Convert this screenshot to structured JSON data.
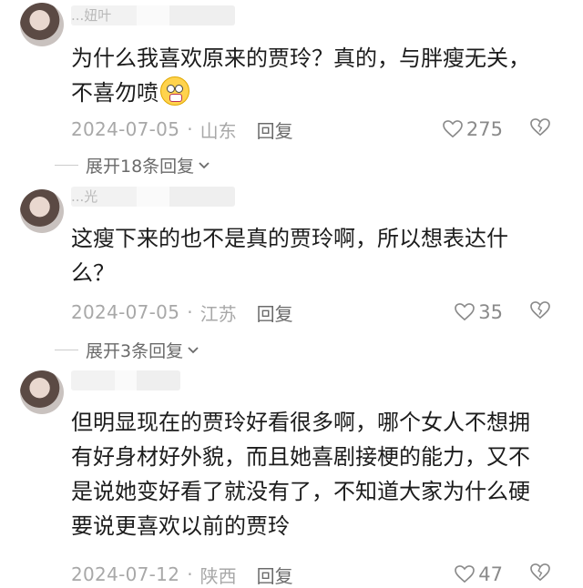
{
  "comments": [
    {
      "username": "...妞叶",
      "text": "为什么我喜欢原来的贾玲？真的，与胖瘦无关，\n不喜勿喷",
      "emoji": "grimace-emoji",
      "date": "2024-07-05",
      "location": "山东",
      "reply": "回复",
      "likes": "275",
      "expand": "展开18条回复"
    },
    {
      "username": "...光",
      "text": "这瘦下来的也不是真的贾玲啊，所以想表达什\n么？",
      "date": "2024-07-05",
      "location": "江苏",
      "reply": "回复",
      "likes": "35",
      "expand": "展开3条回复"
    },
    {
      "username": "",
      "text": "但明显现在的贾玲好看很多啊，哪个女人不想拥\n有好身材好外貌，而且她喜剧接梗的能力，又不\n是说她变好看了就没有了，不知道大家为什么硬\n要说更喜欢以前的贾玲",
      "date": "2024-07-12",
      "location": "陕西",
      "reply": "回复",
      "likes": "47"
    }
  ],
  "separator": "·",
  "icons": {
    "like": "heart-outline-icon",
    "dislike": "broken-heart-icon",
    "expand": "chevron-down-icon"
  },
  "colors": {
    "text": "#1c1c1c",
    "meta": "#a8a8a8",
    "reply": "#6b6b6b"
  }
}
